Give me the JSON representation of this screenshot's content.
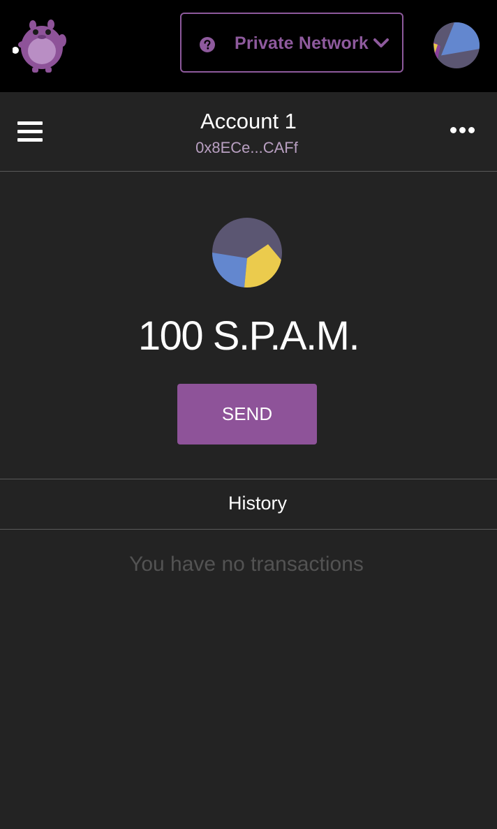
{
  "topbar": {
    "logo_icon": "mascot-logo-icon",
    "network": {
      "icon": "question-circle-icon",
      "label": "Private Network",
      "dropdown_icon": "chevron-down-icon"
    },
    "account_avatar_icon": "identicon-icon"
  },
  "account": {
    "menu_icon": "hamburger-menu-icon",
    "name": "Account 1",
    "address": "0x8ECe...CAFf",
    "options_icon": "more-dots-icon"
  },
  "wallet": {
    "avatar_icon": "token-identicon-icon",
    "balance": "100 S.P.A.M.",
    "send_label": "SEND"
  },
  "history": {
    "title": "History",
    "empty_message": "You have no transactions"
  },
  "colors": {
    "topbar_bg": "#000000",
    "page_bg": "#232323",
    "accent": "#8e5399",
    "address_text": "#b9a0c2",
    "divider": "#5a5a5a",
    "muted_text": "#535353"
  }
}
